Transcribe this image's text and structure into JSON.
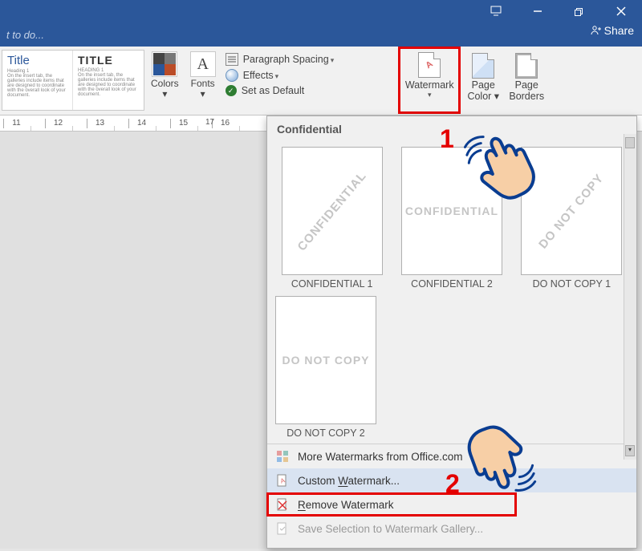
{
  "titlebar": {},
  "bluearea": {
    "tell_me": "t to do...",
    "share": "Share"
  },
  "ribbon": {
    "style1_title": "Title",
    "style1_sub": "Heading 1",
    "style2_title": "TITLE",
    "style2_sub": "HEADING 1",
    "colors": "Colors",
    "fonts": "Fonts",
    "paragraph_spacing": "Paragraph Spacing",
    "effects": "Effects",
    "set_as_default": "Set as Default",
    "watermark": "Watermark",
    "page_color": "Page Color",
    "page_borders": "Page Borders"
  },
  "ruler": {
    "ticks": [
      "11",
      "12",
      "13",
      "14",
      "15",
      "16"
    ],
    "end_marker": "17"
  },
  "dropdown": {
    "section": "Confidential",
    "tiles": [
      {
        "text": "CONFIDENTIAL",
        "label": "CONFIDENTIAL 1",
        "variant": "diag"
      },
      {
        "text": "CONFIDENTIAL",
        "label": "CONFIDENTIAL 2",
        "variant": "horiz"
      },
      {
        "text": "DO NOT COPY",
        "label": "DO NOT COPY 1",
        "variant": "diag"
      },
      {
        "text": "DO NOT COPY",
        "label": "DO NOT COPY 2",
        "variant": "horiz"
      }
    ],
    "menu": {
      "more": "More Watermarks from Office.com",
      "custom_prefix": "Custom ",
      "custom_w": "W",
      "custom_suffix": "atermark...",
      "remove_prefix": "",
      "remove_r": "R",
      "remove_rest": "emove Watermark",
      "save_sel": "Save Selection to Watermark Gallery..."
    }
  },
  "anno": {
    "one": "1",
    "two": "2"
  }
}
